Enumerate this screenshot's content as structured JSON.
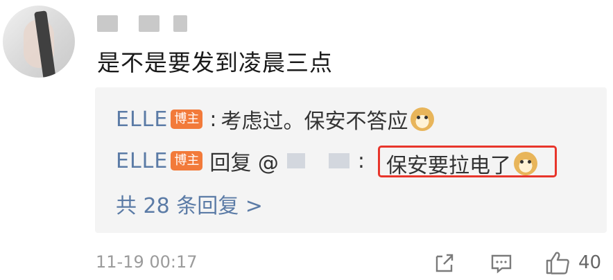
{
  "comment": {
    "text": "是不是要发到凌晨三点"
  },
  "replies": [
    {
      "user": "ELLE",
      "badge": "博主",
      "separator": ":",
      "text": "考虑过。保安不答应"
    },
    {
      "user": "ELLE",
      "badge": "博主",
      "prefix": "回复 @",
      "separator": ":",
      "text": "保安要拉电了"
    }
  ],
  "total_replies": "共 28 条回复 >",
  "timestamp": "11-19 00:17",
  "actions": {
    "share_icon": "share-icon",
    "comment_icon": "comment-icon",
    "like_icon": "thumbs-up-icon",
    "like_count": "40"
  },
  "colors": {
    "username": "#5b7ba6",
    "badge": "#f27a3a",
    "highlight": "#e8352b"
  }
}
